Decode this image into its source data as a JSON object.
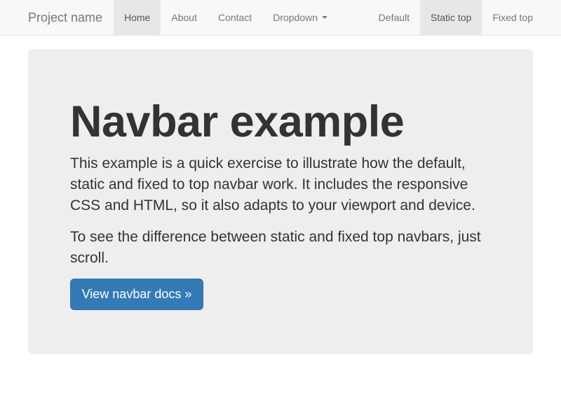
{
  "navbar": {
    "brand": "Project name",
    "left_items": [
      {
        "label": "Home",
        "active": true
      },
      {
        "label": "About",
        "active": false
      },
      {
        "label": "Contact",
        "active": false
      },
      {
        "label": "Dropdown",
        "active": false,
        "icon": "caret-down-icon"
      }
    ],
    "right_items": [
      {
        "label": "Default",
        "active": false
      },
      {
        "label": "Static top",
        "active": true
      },
      {
        "label": "Fixed top",
        "active": false
      }
    ]
  },
  "jumbotron": {
    "title": "Navbar example",
    "paragraph_1": "This example is a quick exercise to illustrate how the default, static and fixed to top navbar work. It includes the responsive CSS and HTML, so it also adapts to your viewport and device.",
    "paragraph_2": "To see the difference between static and fixed top navbars, just scroll.",
    "button_label": "View navbar docs »"
  },
  "colors": {
    "navbar_bg": "#f8f8f8",
    "active_item_bg": "#e7e7e7",
    "jumbotron_bg": "#eeeeee",
    "primary_button": "#337ab7"
  }
}
